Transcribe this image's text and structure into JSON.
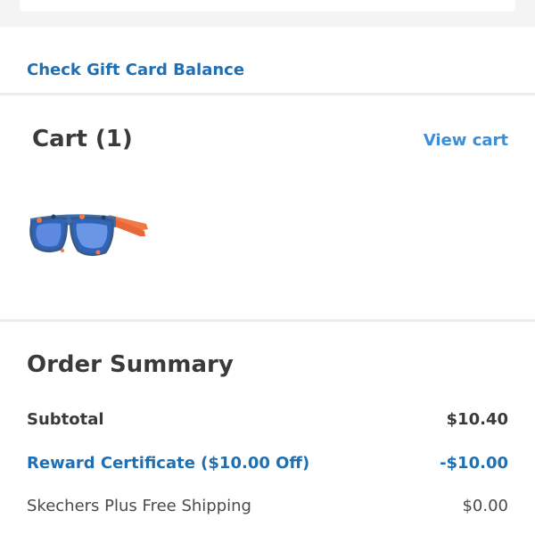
{
  "gift_card": {
    "link_label": "Check Gift Card Balance"
  },
  "cart": {
    "title": "Cart (1)",
    "view_cart_label": "View cart",
    "items": [
      {
        "image": "sunglasses-icon"
      }
    ]
  },
  "order_summary": {
    "title": "Order Summary",
    "subtotal_label": "Subtotal",
    "subtotal_value": "$10.40",
    "reward_label": "Reward Certificate ($10.00 Off)",
    "reward_value": "-$10.00",
    "shipping_label": "Skechers Plus Free Shipping",
    "shipping_value": "$0.00"
  },
  "colors": {
    "link_blue": "#1f6fb2",
    "accent_blue": "#3b8ed8",
    "text_dark": "#3a3a3a",
    "divider": "#ececec"
  }
}
